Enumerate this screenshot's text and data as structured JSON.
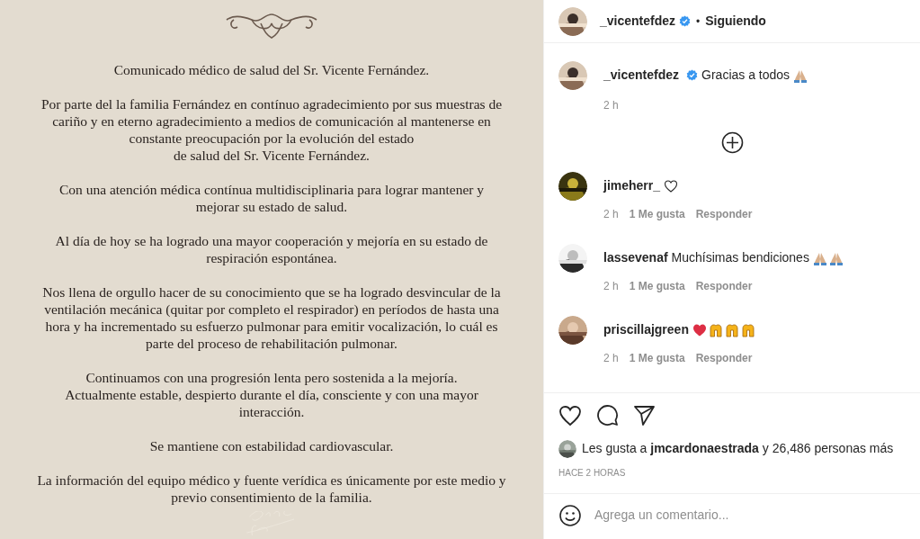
{
  "post_image": {
    "paragraphs": [
      [
        "Comunicado médico de salud del Sr. Vicente Fernández."
      ],
      [
        "Por parte del la familia Fernández en contínuo agradecimiento por sus muestras de",
        "cariño y en eterno agradecimiento a medios de comunicación al mantenerse en",
        "constante preocupación por la evolución del estado",
        "de salud del Sr. Vicente Fernández."
      ],
      [
        "Con una atención médica contínua multidisciplinaria para lograr mantener y",
        "mejorar su estado de salud."
      ],
      [
        "Al día de hoy se ha logrado una mayor cooperación y mejoría en su estado de",
        "respiración espontánea."
      ],
      [
        "Nos llena de orgullo hacer de su conocimiento que se ha logrado desvincular de la",
        "ventilación mecánica (quitar por completo el respirador) en períodos de hasta una",
        "hora y ha incrementado su esfuerzo pulmonar para emitir vocalización, lo cuál es",
        "parte del proceso de rehabilitación pulmonar."
      ],
      [
        "Continuamos con una progresión lenta pero sostenida a la mejoría.",
        "Actualmente estable, despierto durante el día, consciente y con una mayor",
        "interacción."
      ],
      [
        "Se mantiene con estabilidad cardiovascular."
      ],
      [
        "La información del equipo médico y fuente verídica es únicamente por este medio y",
        "previo consentimiento de la familia."
      ]
    ]
  },
  "header": {
    "username": "_vicentefdez",
    "verified": true,
    "separator": "•",
    "follow_label": "Siguiendo"
  },
  "caption": {
    "username": "_vicentefdez",
    "verified": true,
    "text": "Gracias a todos",
    "time": "2 h"
  },
  "comments": [
    {
      "username": "jimeherr_",
      "time": "2 h",
      "likes": "1 Me gusta",
      "reply": "Responder"
    },
    {
      "username": "lassevenaf",
      "text": "Muchísimas bendiciones",
      "time": "2 h",
      "likes": "1 Me gusta",
      "reply": "Responder"
    },
    {
      "username": "priscillajgreen",
      "time": "2 h",
      "likes": "1 Me gusta",
      "reply": "Responder"
    }
  ],
  "likes": {
    "prefix": "Les gusta a",
    "user": "jmcardonaestrada",
    "suffix": "y 26,486 personas más"
  },
  "timestamp": "HACE 2 HORAS",
  "comment_box": {
    "placeholder": "Agrega un comentario..."
  }
}
